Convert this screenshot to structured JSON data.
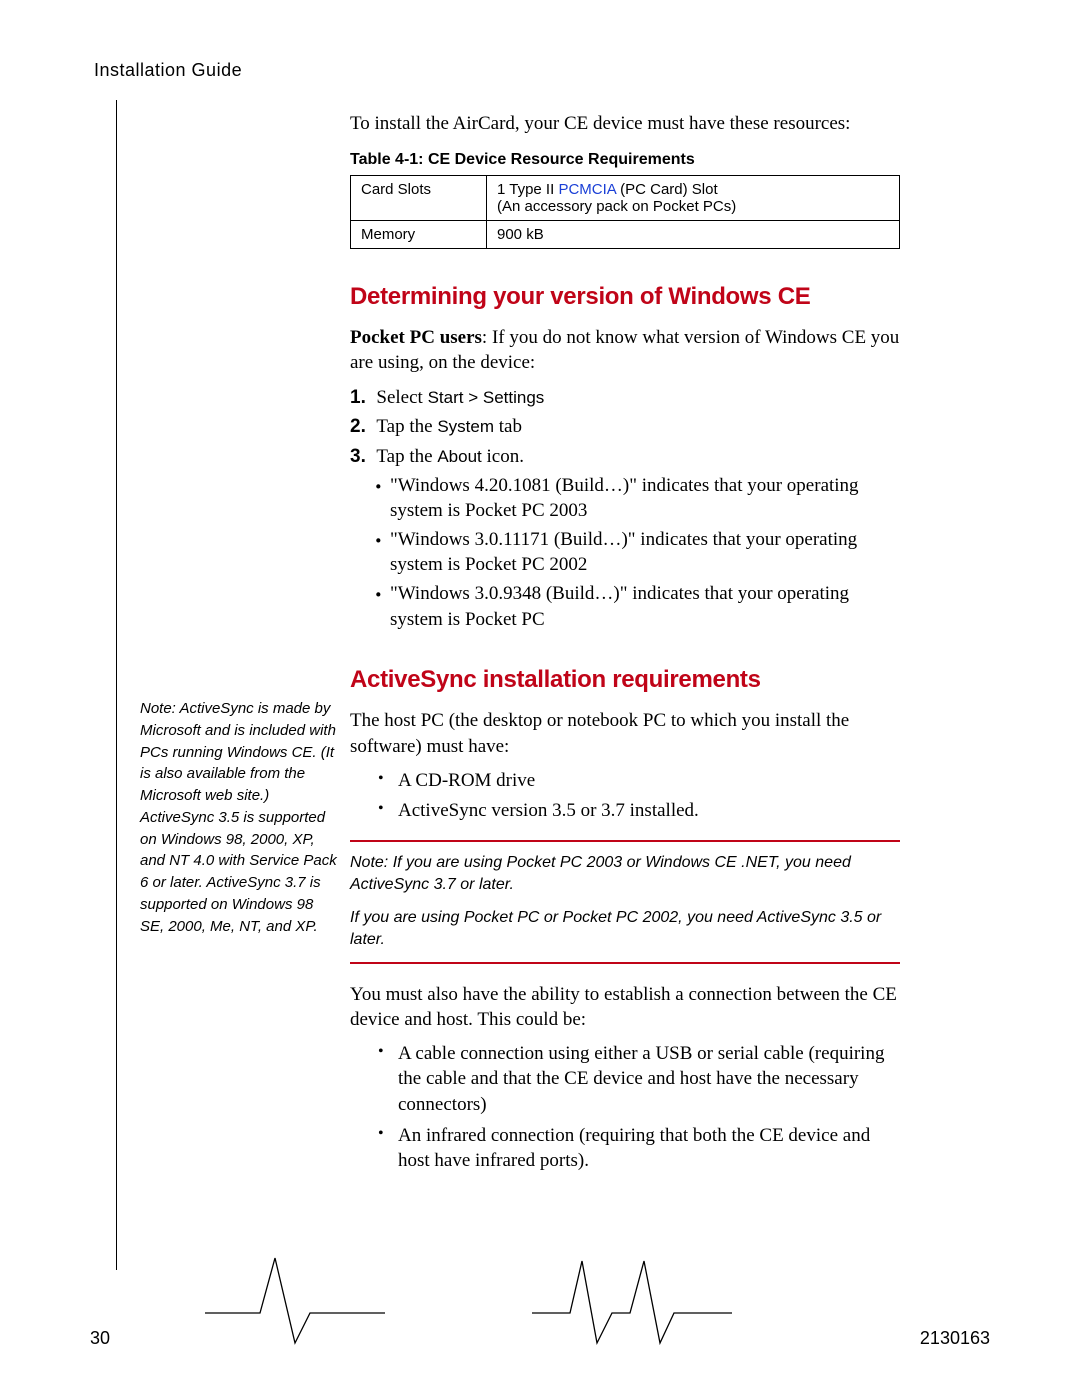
{
  "header": {
    "title": "Installation Guide"
  },
  "intro": "To install the AirCard, your CE device must have these resources:",
  "table": {
    "caption": "Table 4-1: CE Device Resource Requirements",
    "rows": [
      {
        "label": "Card Slots",
        "prefix": "1 Type II ",
        "link": "PCMCIA",
        "suffix": " (PC Card) Slot\n(An accessory pack on Pocket PCs)"
      },
      {
        "label": "Memory",
        "value": "900 kB"
      }
    ]
  },
  "section1": {
    "title": "Determining your version of Windows CE",
    "para_lead": "Pocket PC users",
    "para_rest": ": If you do not know what version of Windows CE you are using, on the device:",
    "steps": {
      "s1_a": "Select ",
      "s1_b": "Start > Settings",
      "s2_a": "Tap the ",
      "s2_b": "System",
      "s2_c": " tab",
      "s3_a": "Tap the ",
      "s3_b": "About",
      "s3_c": " icon."
    },
    "subs": [
      "\"Windows 4.20.1081 (Build…)\" indicates that your operating system is Pocket PC 2003",
      "\"Windows 3.0.11171 (Build…)\" indicates that your operating system is Pocket PC 2002",
      "\"Windows 3.0.9348 (Build…)\" indicates that your operating system is Pocket PC"
    ]
  },
  "side_note": "Note: ActiveSync is made by Microsoft and is included with PCs running Windows CE. (It is also available from the Microsoft web site.) ActiveSync 3.5 is supported on Windows 98, 2000, XP, and NT 4.0 with Service Pack 6 or later. ActiveSync 3.7 is supported on Windows 98 SE, 2000, Me, NT, and XP.",
  "section2": {
    "title": "ActiveSync installation requirements",
    "para1": "The host PC (the desktop or notebook PC to which you install the software) must have:",
    "bul1": [
      "A CD-ROM drive",
      "ActiveSync version 3.5 or 3.7 installed."
    ],
    "note_line1": "Note: If you are using Pocket PC 2003 or Windows CE .NET, you need ActiveSync 3.7 or later.",
    "note_line2": "If you are using Pocket PC or  Pocket PC 2002, you need ActiveSync 3.5 or later.",
    "para2": "You must also have the ability to establish a connection between the CE device and host. This could be:",
    "bul2": [
      "A cable connection using either a USB or serial cable (requiring the cable and that the CE device and host have the necessary connectors)",
      "An infrared connection (requiring that both the CE device and host have infrared ports)."
    ]
  },
  "footer": {
    "page": "30",
    "docnum": "2130163"
  }
}
